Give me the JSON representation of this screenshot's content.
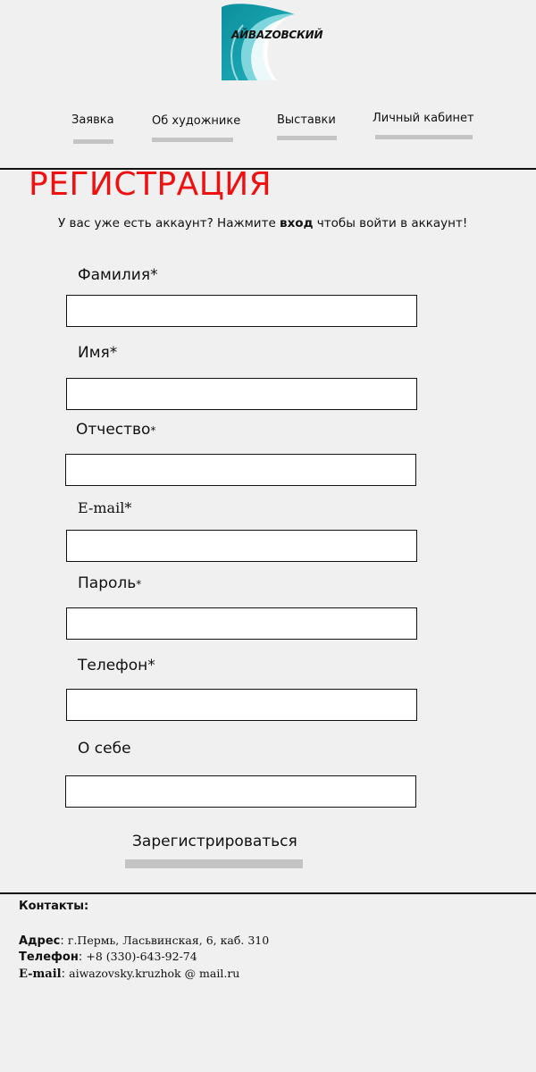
{
  "brand": {
    "name": "АЙВАZОВСКИЙ",
    "colors": {
      "wave_dark": "#0f9aa6",
      "wave_light": "#7fd6dc",
      "wave_white": "#ffffff"
    }
  },
  "nav": {
    "items": [
      {
        "label": "Заявка"
      },
      {
        "label": "Об художнике"
      },
      {
        "label": "Выставки"
      },
      {
        "label": "Личный кабинет"
      }
    ]
  },
  "page": {
    "title": "РЕГИСТРАЦИЯ",
    "title_color": "#ee1111",
    "login_note": {
      "before": "У вас уже есть аккаунт? Нажмите ",
      "link": "вход",
      "after": " чтобы войти в аккаунт!"
    }
  },
  "form": {
    "fields": [
      {
        "label": "Фамилия",
        "required_mark": "*",
        "value": ""
      },
      {
        "label": "Имя",
        "required_mark": "*",
        "value": ""
      },
      {
        "label": "Отчество",
        "required_mark": "*",
        "value": ""
      },
      {
        "label": "E-mail",
        "required_mark": "*",
        "value": ""
      },
      {
        "label": "Пароль",
        "required_mark": "*",
        "value": ""
      },
      {
        "label": "Телефон",
        "required_mark": "*",
        "value": ""
      },
      {
        "label": "О себе",
        "required_mark": "",
        "value": ""
      }
    ],
    "submit_label": "Зарегистрироваться"
  },
  "contacts": {
    "title": "Контакты:",
    "address_key": "Адрес",
    "address_value": "г.Пермь, Ласьвинская, 6, каб. 310",
    "phone_key": "Телефон",
    "phone_value": "+8 (330)-643-92-74",
    "email_key": "E-mail",
    "email_value": "aiwazovsky.kruzhok @ mail.ru"
  }
}
